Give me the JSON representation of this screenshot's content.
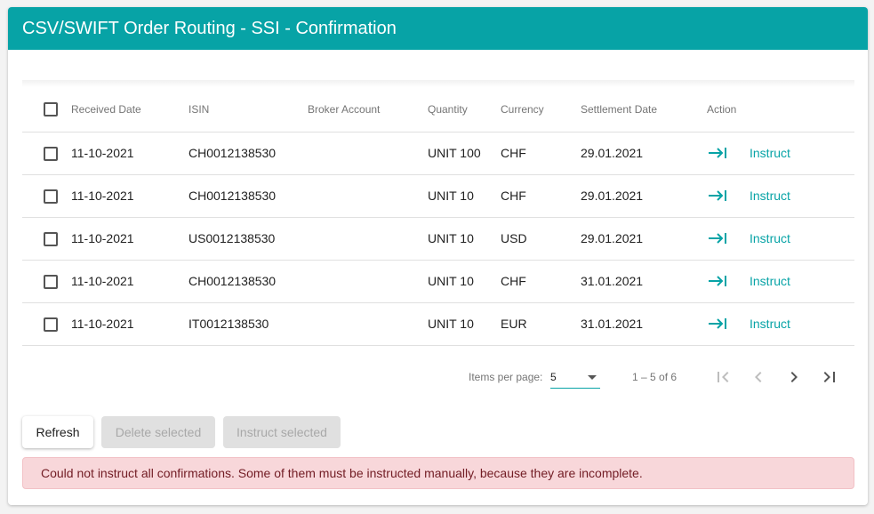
{
  "header": {
    "title": "CSV/SWIFT Order Routing - SSI - Confirmation"
  },
  "table": {
    "columns": [
      "Received Date",
      "ISIN",
      "Broker Account",
      "Quantity",
      "Currency",
      "Settlement Date",
      "Action"
    ],
    "rows": [
      {
        "received": "11-10-2021",
        "isin": "CH0012138530",
        "broker": "",
        "qty": "UNIT 100",
        "currency": "CHF",
        "settlement": "29.01.2021",
        "action": "Instruct"
      },
      {
        "received": "11-10-2021",
        "isin": "CH0012138530",
        "broker": "",
        "qty": "UNIT 10",
        "currency": "CHF",
        "settlement": "29.01.2021",
        "action": "Instruct"
      },
      {
        "received": "11-10-2021",
        "isin": "US0012138530",
        "broker": "",
        "qty": "UNIT 10",
        "currency": "USD",
        "settlement": "29.01.2021",
        "action": "Instruct"
      },
      {
        "received": "11-10-2021",
        "isin": "CH0012138530",
        "broker": "",
        "qty": "UNIT 10",
        "currency": "CHF",
        "settlement": "31.01.2021",
        "action": "Instruct"
      },
      {
        "received": "11-10-2021",
        "isin": "IT0012138530",
        "broker": "",
        "qty": "UNIT 10",
        "currency": "EUR",
        "settlement": "31.01.2021",
        "action": "Instruct"
      }
    ]
  },
  "paginator": {
    "items_per_page_label": "Items per page:",
    "page_size": "5",
    "range": "1 – 5 of 6"
  },
  "buttons": {
    "refresh": "Refresh",
    "delete_selected": "Delete selected",
    "instruct_selected": "Instruct selected"
  },
  "alert": {
    "message": "Could not instruct all confirmations. Some of them must be instructed manually, because they are incomplete."
  },
  "colors": {
    "accent": "#07a3a6",
    "alert_bg": "#f8d7da",
    "alert_text": "#721c24"
  },
  "icons": {
    "instruct": "arrow-right-to-bar-icon",
    "first_page": "first-page-icon",
    "prev_page": "chevron-left-icon",
    "next_page": "chevron-right-icon",
    "last_page": "last-page-icon"
  }
}
